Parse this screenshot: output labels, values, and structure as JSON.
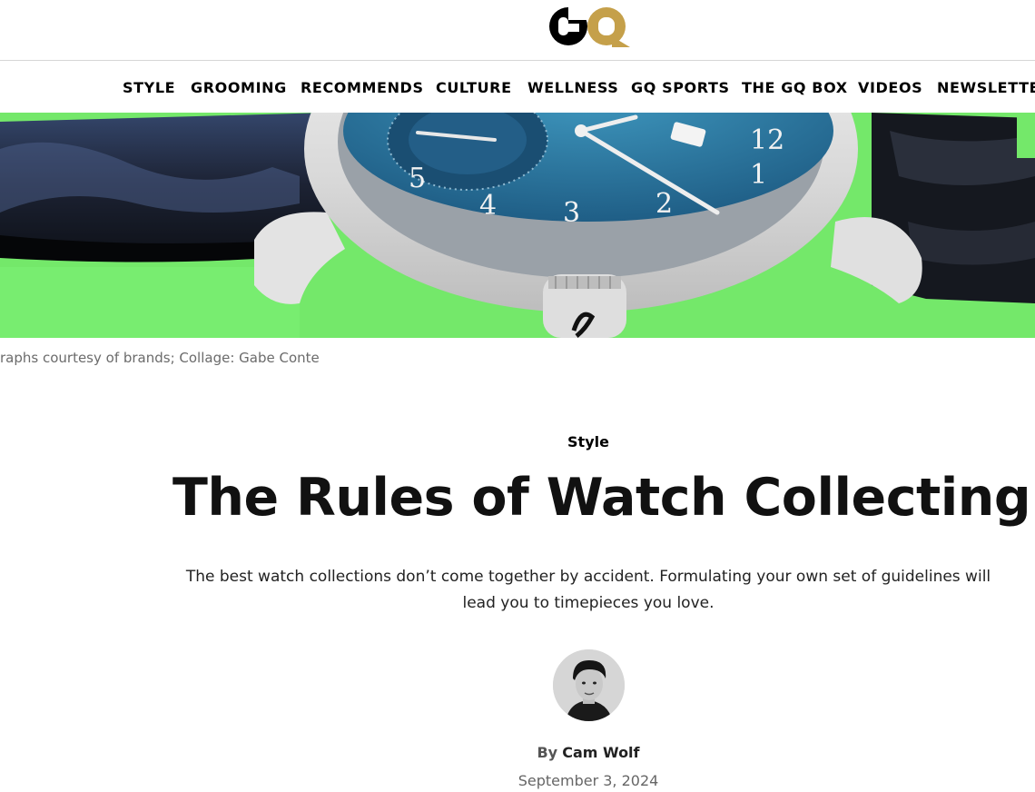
{
  "brand": {
    "logo_text": "GQ",
    "colors": {
      "g": "#000000",
      "q": "#c5a04a"
    }
  },
  "nav": {
    "items": [
      {
        "label": "STYLE"
      },
      {
        "label": "GROOMING"
      },
      {
        "label": "RECOMMENDS"
      },
      {
        "label": "CULTURE"
      },
      {
        "label": "WELLNESS"
      },
      {
        "label": "GQ SPORTS"
      },
      {
        "label": "THE GQ BOX"
      },
      {
        "label": "VIDEOS"
      },
      {
        "label": "NEWSLETTE"
      }
    ]
  },
  "hero": {
    "background_color": "#74e86a",
    "dial_numerals": [
      "12",
      "1",
      "2",
      "3",
      "4",
      "5"
    ]
  },
  "caption": "raphs courtesy of brands; Collage: Gabe Conte",
  "article": {
    "rubric": "Style",
    "headline": "The Rules of Watch Collecting",
    "dek": "The best watch collections don’t come together by accident. Formulating your own set of guidelines will lead you to timepieces you love.",
    "byline_prefix": "By",
    "author": "Cam Wolf",
    "date": "September 3, 2024"
  }
}
